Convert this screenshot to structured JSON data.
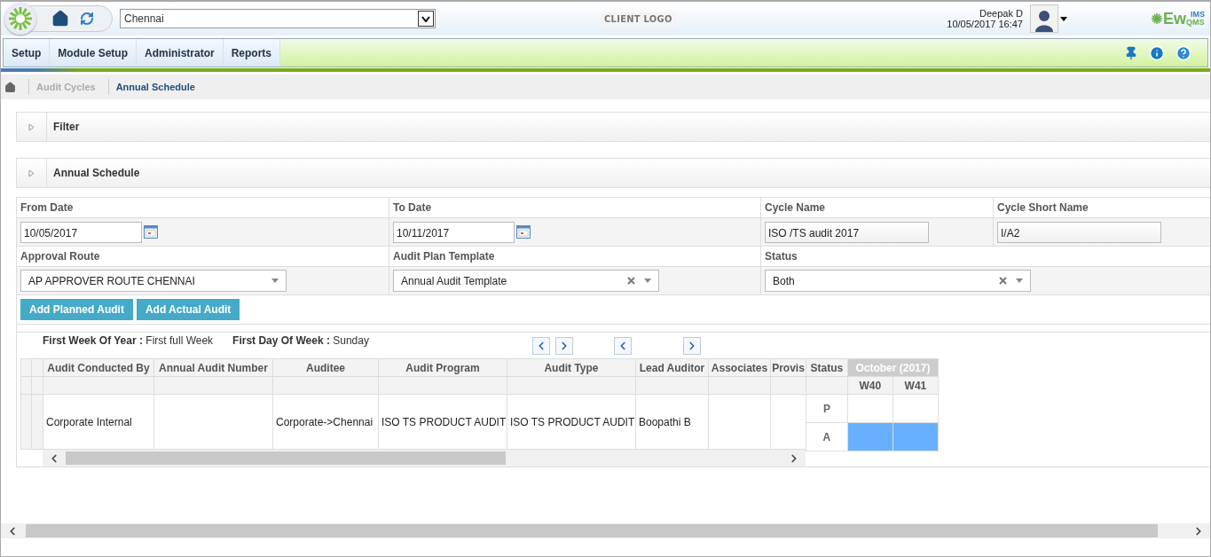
{
  "header": {
    "location": "Chennai",
    "client_logo": {
      "title": "CLIENT LOGO"
    },
    "user": {
      "name": "Deepak D",
      "datetime": "10/05/2017 16:47"
    },
    "brand": {
      "main": "Ew",
      "sup": "IMS",
      "sub": "QMS"
    }
  },
  "menu": {
    "items": [
      {
        "label": "Setup"
      },
      {
        "label": "Module Setup"
      },
      {
        "label": "Administrator"
      },
      {
        "label": "Reports"
      }
    ]
  },
  "breadcrumb": [
    {
      "label": "Audit Cycles",
      "selected": false
    },
    {
      "label": "Annual Schedule",
      "selected": true
    }
  ],
  "panels": [
    {
      "title": "Filter"
    },
    {
      "title": "Annual Schedule"
    }
  ],
  "form": {
    "rows": [
      {
        "fields": [
          {
            "label": "From Date",
            "kind": "date",
            "value": "10/05/2017"
          },
          {
            "label": "To Date",
            "kind": "date",
            "value": "10/11/2017"
          },
          {
            "label": "Cycle Name",
            "kind": "text",
            "value": "ISO /TS audit 2017"
          },
          {
            "label": "Cycle Short Name",
            "kind": "text",
            "value": "I/A2"
          }
        ]
      },
      {
        "fields": [
          {
            "label": "Approval Route",
            "kind": "select",
            "value": "AP APPROVER ROUTE CHENNAI",
            "clearable": false
          },
          {
            "label": "Audit Plan Template",
            "kind": "select",
            "value": "Annual Audit Template",
            "clearable": true
          },
          {
            "label": "Status",
            "kind": "select",
            "value": "Both",
            "clearable": true
          }
        ]
      }
    ],
    "buttons": [
      "Add Planned Audit",
      "Add Actual Audit"
    ]
  },
  "schedule_info": [
    {
      "label": "First Week Of Year :",
      "value": "First full Week"
    },
    {
      "label": "First Day Of Week :",
      "value": "Sunday"
    }
  ],
  "table": {
    "columns": [
      "Audit Conducted By",
      "Annual Audit Number",
      "Auditee",
      "Audit Program",
      "Audit Type",
      "Lead Auditor",
      "Associates",
      "Provis"
    ],
    "rows": [
      [
        "Corporate Internal",
        "",
        "Corporate->Chennai",
        "ISO TS PRODUCT AUDIT",
        "ISO TS PRODUCT AUDIT",
        "Boopathi B",
        "",
        ""
      ]
    ]
  },
  "calendar": {
    "status_header": "Status",
    "month": "October (2017)",
    "weeks": [
      "W40",
      "W41"
    ],
    "rows": [
      {
        "label": "P",
        "cells": [
          {
            "filled": false
          },
          {
            "filled": false
          }
        ]
      },
      {
        "label": "A",
        "cells": [
          {
            "filled": true
          },
          {
            "filled": true
          }
        ]
      }
    ]
  }
}
